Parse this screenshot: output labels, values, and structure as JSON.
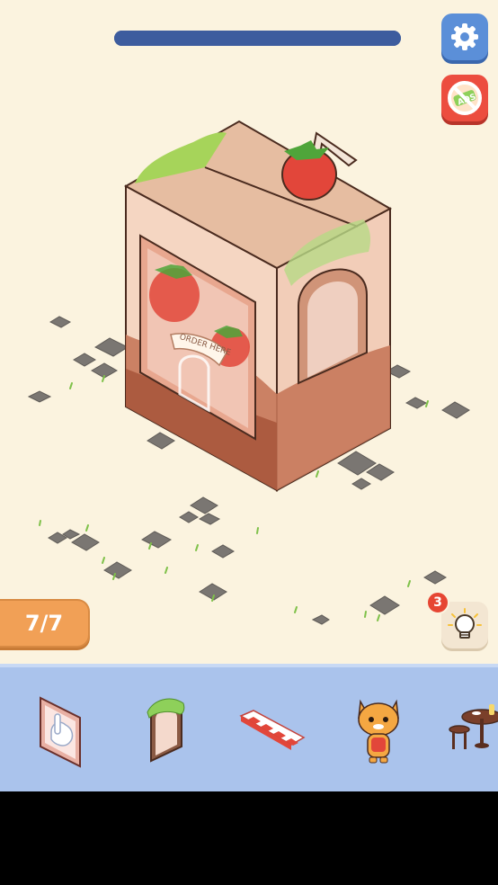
{
  "hud": {
    "progress_fraction": 1.0,
    "level_progress": "7/7",
    "hint_count": "3"
  },
  "icons": {
    "settings": "gear-icon",
    "no_ads": "no-ads-icon",
    "hint": "lightbulb-icon"
  },
  "scene": {
    "sign_text": "ORDER HERE"
  },
  "tray": {
    "items": [
      {
        "name": "glass-door-item"
      },
      {
        "name": "arched-window-item"
      },
      {
        "name": "striped-awning-item"
      },
      {
        "name": "cat-mascot-item"
      },
      {
        "name": "cafe-table-set-item"
      }
    ]
  },
  "colors": {
    "background": "#fbf3df",
    "progress": "#3d5c9e",
    "settings_button": "#5b8fd8",
    "no_ads_button": "#ec4d3f",
    "level_badge": "#f1a056",
    "tray": "#aac3ec"
  }
}
